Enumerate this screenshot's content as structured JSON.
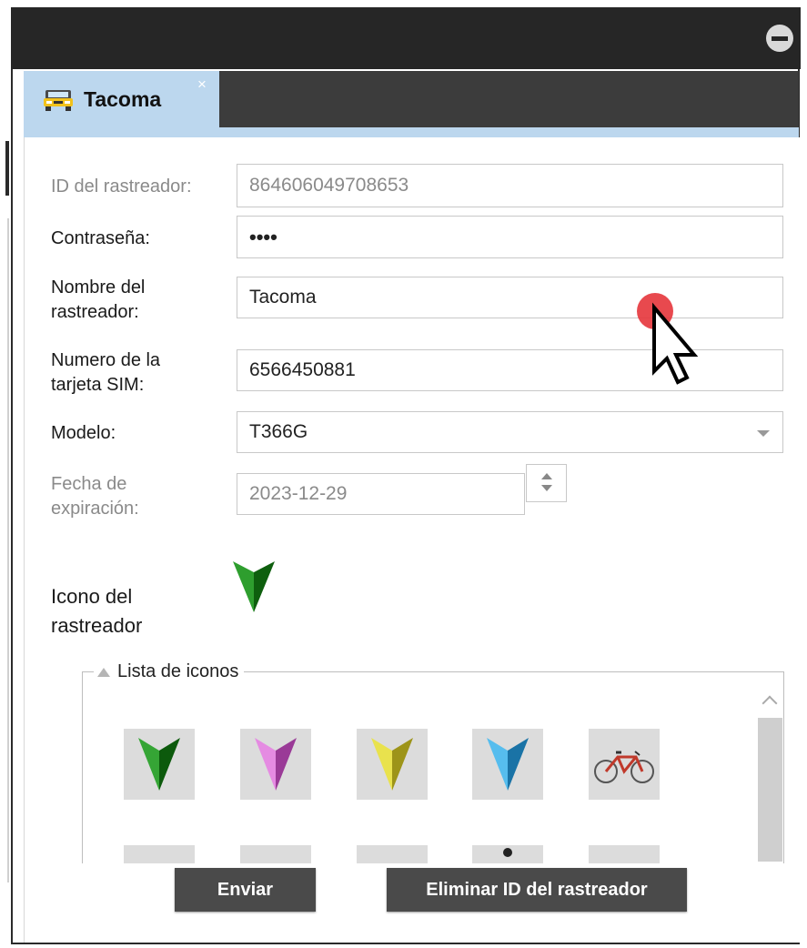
{
  "window": {
    "tab_title": "Tacoma",
    "tab_close": "×",
    "tab_icon": "car-icon"
  },
  "form": {
    "tracker_id_label": "ID del rastreador:",
    "tracker_id_value": "864606049708653",
    "password_label": "Contraseña:",
    "password_value": "••••",
    "name_label_line1": "Nombre del",
    "name_label_line2": "rastreador:",
    "name_value": "Tacoma",
    "sim_label_line1": "Numero de la",
    "sim_label_line2": "tarjeta SIM:",
    "sim_value": "6566450881",
    "model_label": "Modelo:",
    "model_value": "T366G",
    "expiry_label_line1": "Fecha de",
    "expiry_label_line2": "expiración:",
    "expiry_value": "2023-12-29",
    "icon_label_line1": "Icono del",
    "icon_label_line2": "rastreador",
    "selected_icon": "green-arrow-icon"
  },
  "icon_list": {
    "legend": "Lista de iconos",
    "icons": [
      "green-arrow-icon",
      "magenta-arrow-icon",
      "yellow-arrow-icon",
      "blue-arrow-icon",
      "bicycle-icon"
    ],
    "colors": {
      "green": "#1f8a1f",
      "magenta": "#d96fd6",
      "yellow": "#d8cf3a",
      "blue": "#3ba7dc"
    }
  },
  "buttons": {
    "submit": "Enviar",
    "delete": "Eliminar ID del rastreador"
  }
}
